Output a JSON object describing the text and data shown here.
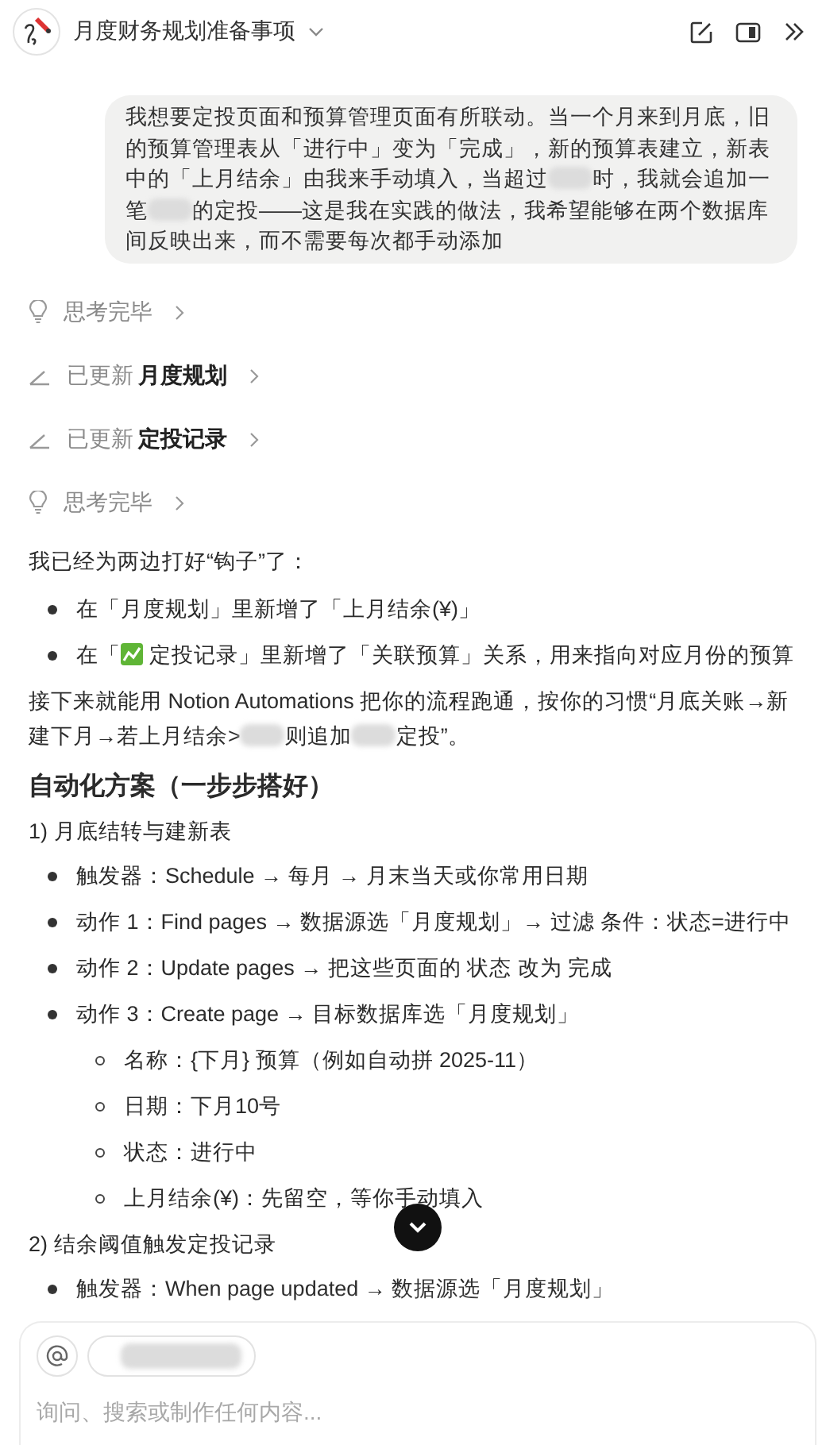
{
  "header": {
    "title": "月度财务规划准备事项"
  },
  "user_message": {
    "parts": [
      {
        "kind": "text",
        "text": "我想要定投页面和预算管理页面有所联动。当一个月来到月底，旧的预算管理表从「进行中」变为「完成」，新的预算表建立，新表中的「上月结余」由我来手动填入，当超过"
      },
      {
        "kind": "redacted"
      },
      {
        "kind": "text",
        "text": "时，我就会追加一笔"
      },
      {
        "kind": "redacted"
      },
      {
        "kind": "text",
        "text": "的定投——这是我在实践的做法，我希望能够在两个数据库间反映出来，而不需要每次都手动添加"
      }
    ]
  },
  "steps": [
    {
      "kind": "thought",
      "label": "思考完毕"
    },
    {
      "kind": "update",
      "label": "已更新",
      "target": "月度规划"
    },
    {
      "kind": "update",
      "label": "已更新",
      "target": "定投记录"
    },
    {
      "kind": "thought",
      "label": "思考完毕"
    }
  ],
  "reply": [
    {
      "kind": "paragraph",
      "parts": [
        {
          "kind": "text",
          "text": "我已经为两边打好“钩子”了："
        }
      ]
    },
    {
      "kind": "bullets",
      "items": [
        {
          "parts": [
            {
              "kind": "text",
              "text": "在「月度规划」里新增了「上月结余(¥)」"
            }
          ]
        },
        {
          "parts": [
            {
              "kind": "text",
              "text": "在「"
            },
            {
              "kind": "emoji"
            },
            {
              "kind": "text",
              "text": " 定投记录」里新增了「关联预算」关系，用来指向对应月份的预算"
            }
          ]
        }
      ]
    },
    {
      "kind": "paragraph",
      "parts": [
        {
          "kind": "text",
          "text": "接下来就能用 Notion Automations 把你的流程跑通，按你的习惯“月底关账→新建下月→若上月结余>"
        },
        {
          "kind": "redacted"
        },
        {
          "kind": "text",
          "text": "则追加"
        },
        {
          "kind": "redacted"
        },
        {
          "kind": "text",
          "text": "定投”。"
        }
      ]
    },
    {
      "kind": "heading",
      "parts": [
        {
          "kind": "text",
          "text": "自动化方案（一步步搭好）"
        }
      ]
    },
    {
      "kind": "subheading",
      "parts": [
        {
          "kind": "text",
          "text": "1) 月底结转与建新表"
        }
      ]
    },
    {
      "kind": "bullets",
      "items": [
        {
          "parts": [
            {
              "kind": "text",
              "text": "触发器：Schedule → 每月 → 月末当天或你常用日期"
            }
          ]
        },
        {
          "parts": [
            {
              "kind": "text",
              "text": "动作 1：Find pages → 数据源选「月度规划」→ 过滤 条件：状态=进行中"
            }
          ]
        },
        {
          "parts": [
            {
              "kind": "text",
              "text": "动作 2：Update pages → 把这些页面的 状态 改为 完成"
            }
          ]
        },
        {
          "parts": [
            {
              "kind": "text",
              "text": "动作 3：Create page → 目标数据库选「月度规划」"
            }
          ],
          "children": [
            {
              "parts": [
                {
                  "kind": "text",
                  "text": "名称：{下月} 预算（例如自动拼 2025-11）"
                }
              ]
            },
            {
              "parts": [
                {
                  "kind": "text",
                  "text": "日期：下月10号"
                }
              ]
            },
            {
              "parts": [
                {
                  "kind": "text",
                  "text": "状态：进行中"
                }
              ]
            },
            {
              "parts": [
                {
                  "kind": "text",
                  "text": "上月结余(¥)：先留空，等你手动填入"
                }
              ]
            }
          ]
        }
      ]
    },
    {
      "kind": "subheading",
      "parts": [
        {
          "kind": "text",
          "text": "2) 结余阈值触发定投记录"
        }
      ]
    },
    {
      "kind": "bullets",
      "items": [
        {
          "parts": [
            {
              "kind": "text",
              "text": "触发器：When page updated → 数据源选「月度规划」"
            }
          ]
        }
      ]
    }
  ],
  "composer": {
    "placeholder": "询问、搜索或制作任何内容..."
  }
}
